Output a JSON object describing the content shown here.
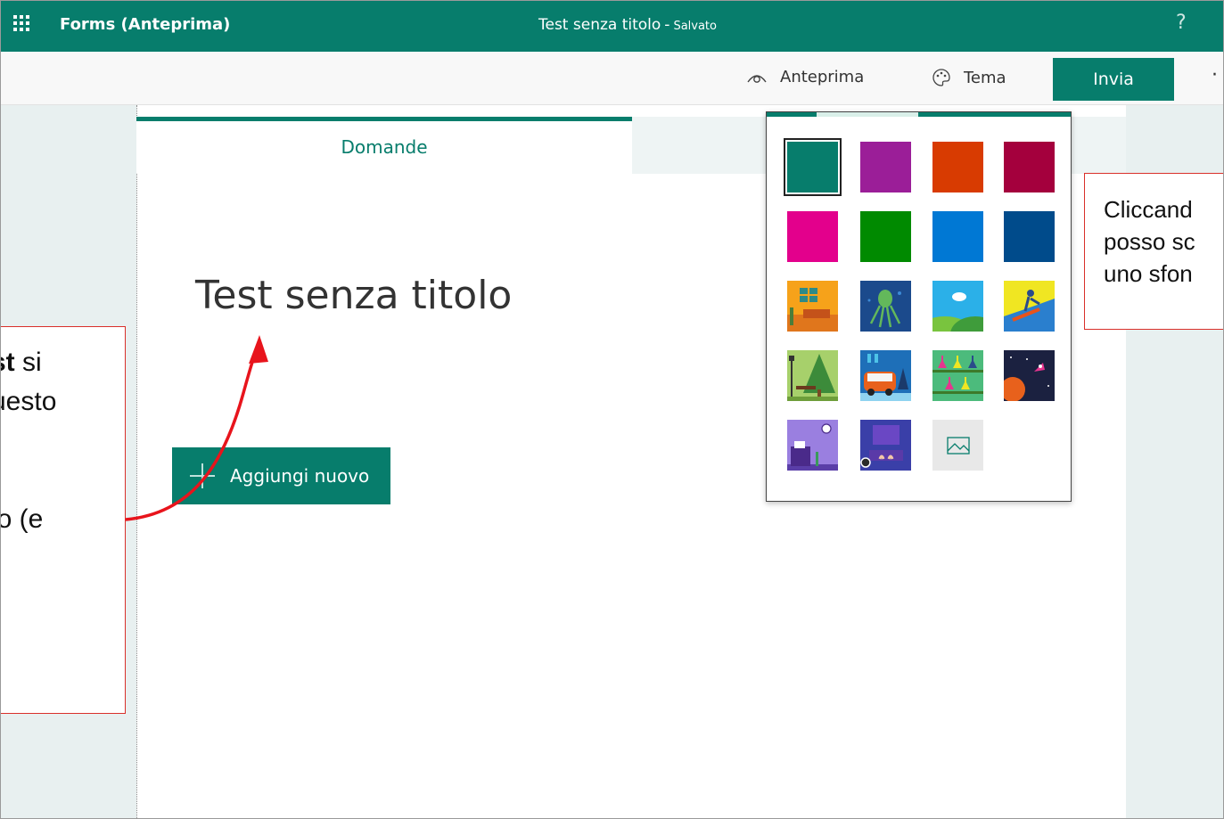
{
  "app": {
    "name": "Forms (Anteprima)"
  },
  "document": {
    "title": "Test senza titolo",
    "separator": "-",
    "save_status": "Salvato"
  },
  "header": {
    "help_label": "?"
  },
  "commandbar": {
    "preview_label": "Anteprima",
    "theme_label": "Tema",
    "send_label": "Invia",
    "more_label": "·"
  },
  "tabs": {
    "questions_label": "Domande"
  },
  "form": {
    "title": "Test senza titolo",
    "add_new_label": "Aggiungi nuovo"
  },
  "theme_panel": {
    "colors": [
      "#077d6c",
      "#9b1e98",
      "#d83b01",
      "#a4003d",
      "#e3008c",
      "#008a00",
      "#0078d4",
      "#004b8b"
    ],
    "image_themes": [
      "living-room",
      "octopus",
      "landscape",
      "snowboard",
      "park",
      "van",
      "science",
      "space",
      "desk",
      "keyboard"
    ],
    "upload_icon": "image-icon"
  },
  "annotations": {
    "left": [
      "st si",
      "uesto",
      "",
      ".",
      "lo (e"
    ],
    "left_bold": "st",
    "left_plain": " si",
    "right": [
      "Cliccand",
      "posso sc",
      "uno sfon"
    ]
  },
  "colors": {
    "brand": "#077d6c",
    "annotation_border": "#d9302a",
    "arrow": "#e8141c"
  }
}
